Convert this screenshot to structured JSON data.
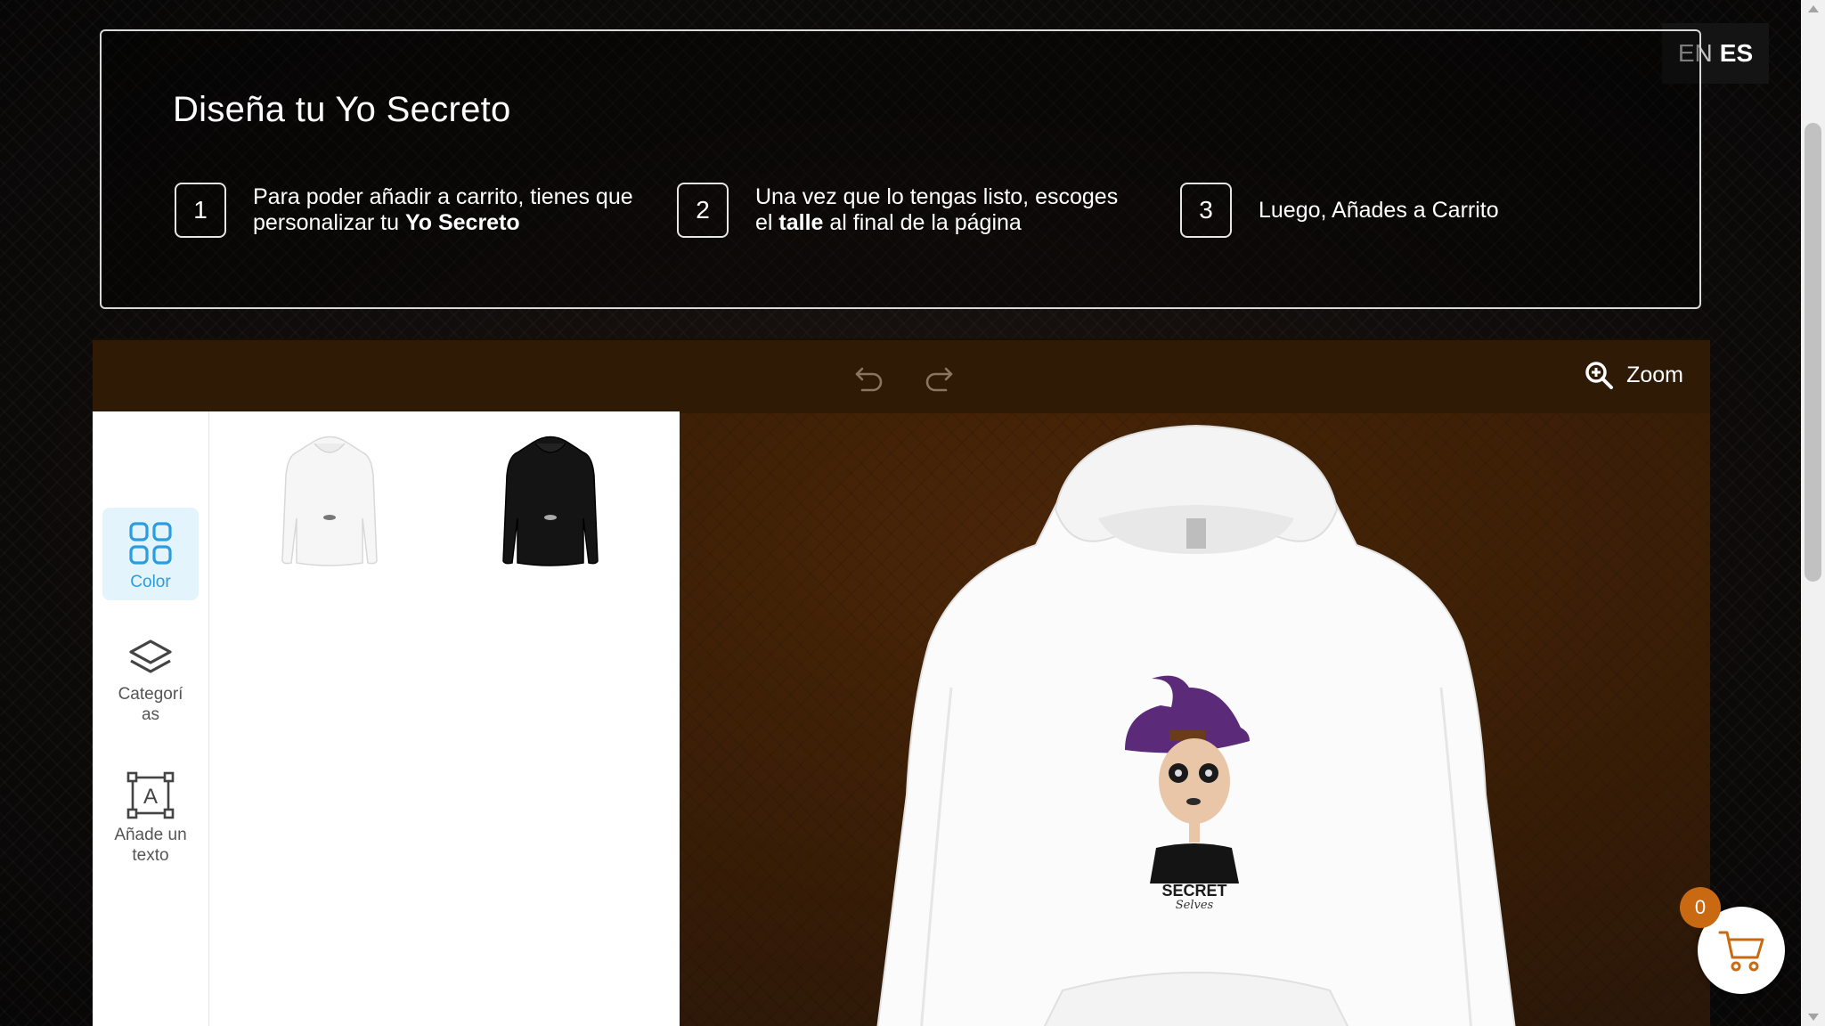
{
  "language": {
    "options": [
      "EN",
      "ES"
    ],
    "active": "ES"
  },
  "intro": {
    "title": "Diseña tu Yo Secreto",
    "steps": [
      {
        "number": "1",
        "text_before": "Para poder añadir a carrito, tienes que personalizar tu ",
        "bold": "Yo Secreto",
        "text_after": ""
      },
      {
        "number": "2",
        "text_before": "Una vez que lo tengas listo, escoges el ",
        "bold": "talle",
        "text_after": " al final de la página"
      },
      {
        "number": "3",
        "text_before": "Luego, Añades a Carrito",
        "bold": "",
        "text_after": ""
      }
    ]
  },
  "toolbar": {
    "undo_icon": "undo-icon",
    "redo_icon": "redo-icon",
    "zoom_label": "Zoom",
    "zoom_icon": "zoom-in-icon"
  },
  "sidebar": {
    "items": [
      {
        "label": "Color",
        "icon": "grid-icon",
        "active": true
      },
      {
        "label": "Categorías",
        "icon": "layers-icon",
        "active": false
      },
      {
        "label": "Añade un texto",
        "icon": "text-box-icon",
        "active": false
      }
    ]
  },
  "panel": {
    "products": [
      {
        "name": "white-hoodie",
        "color": "#ffffff"
      },
      {
        "name": "black-hoodie",
        "color": "#111111"
      }
    ]
  },
  "design": {
    "brand_text": "SECRET",
    "brand_script": "Selves"
  },
  "cart": {
    "count": "0",
    "icon": "cart-icon"
  },
  "colors": {
    "accent": "#2a9de0",
    "toolbar": "#2e1a05",
    "cart_badge": "#c96a12",
    "cart_icon": "#c96a12"
  }
}
